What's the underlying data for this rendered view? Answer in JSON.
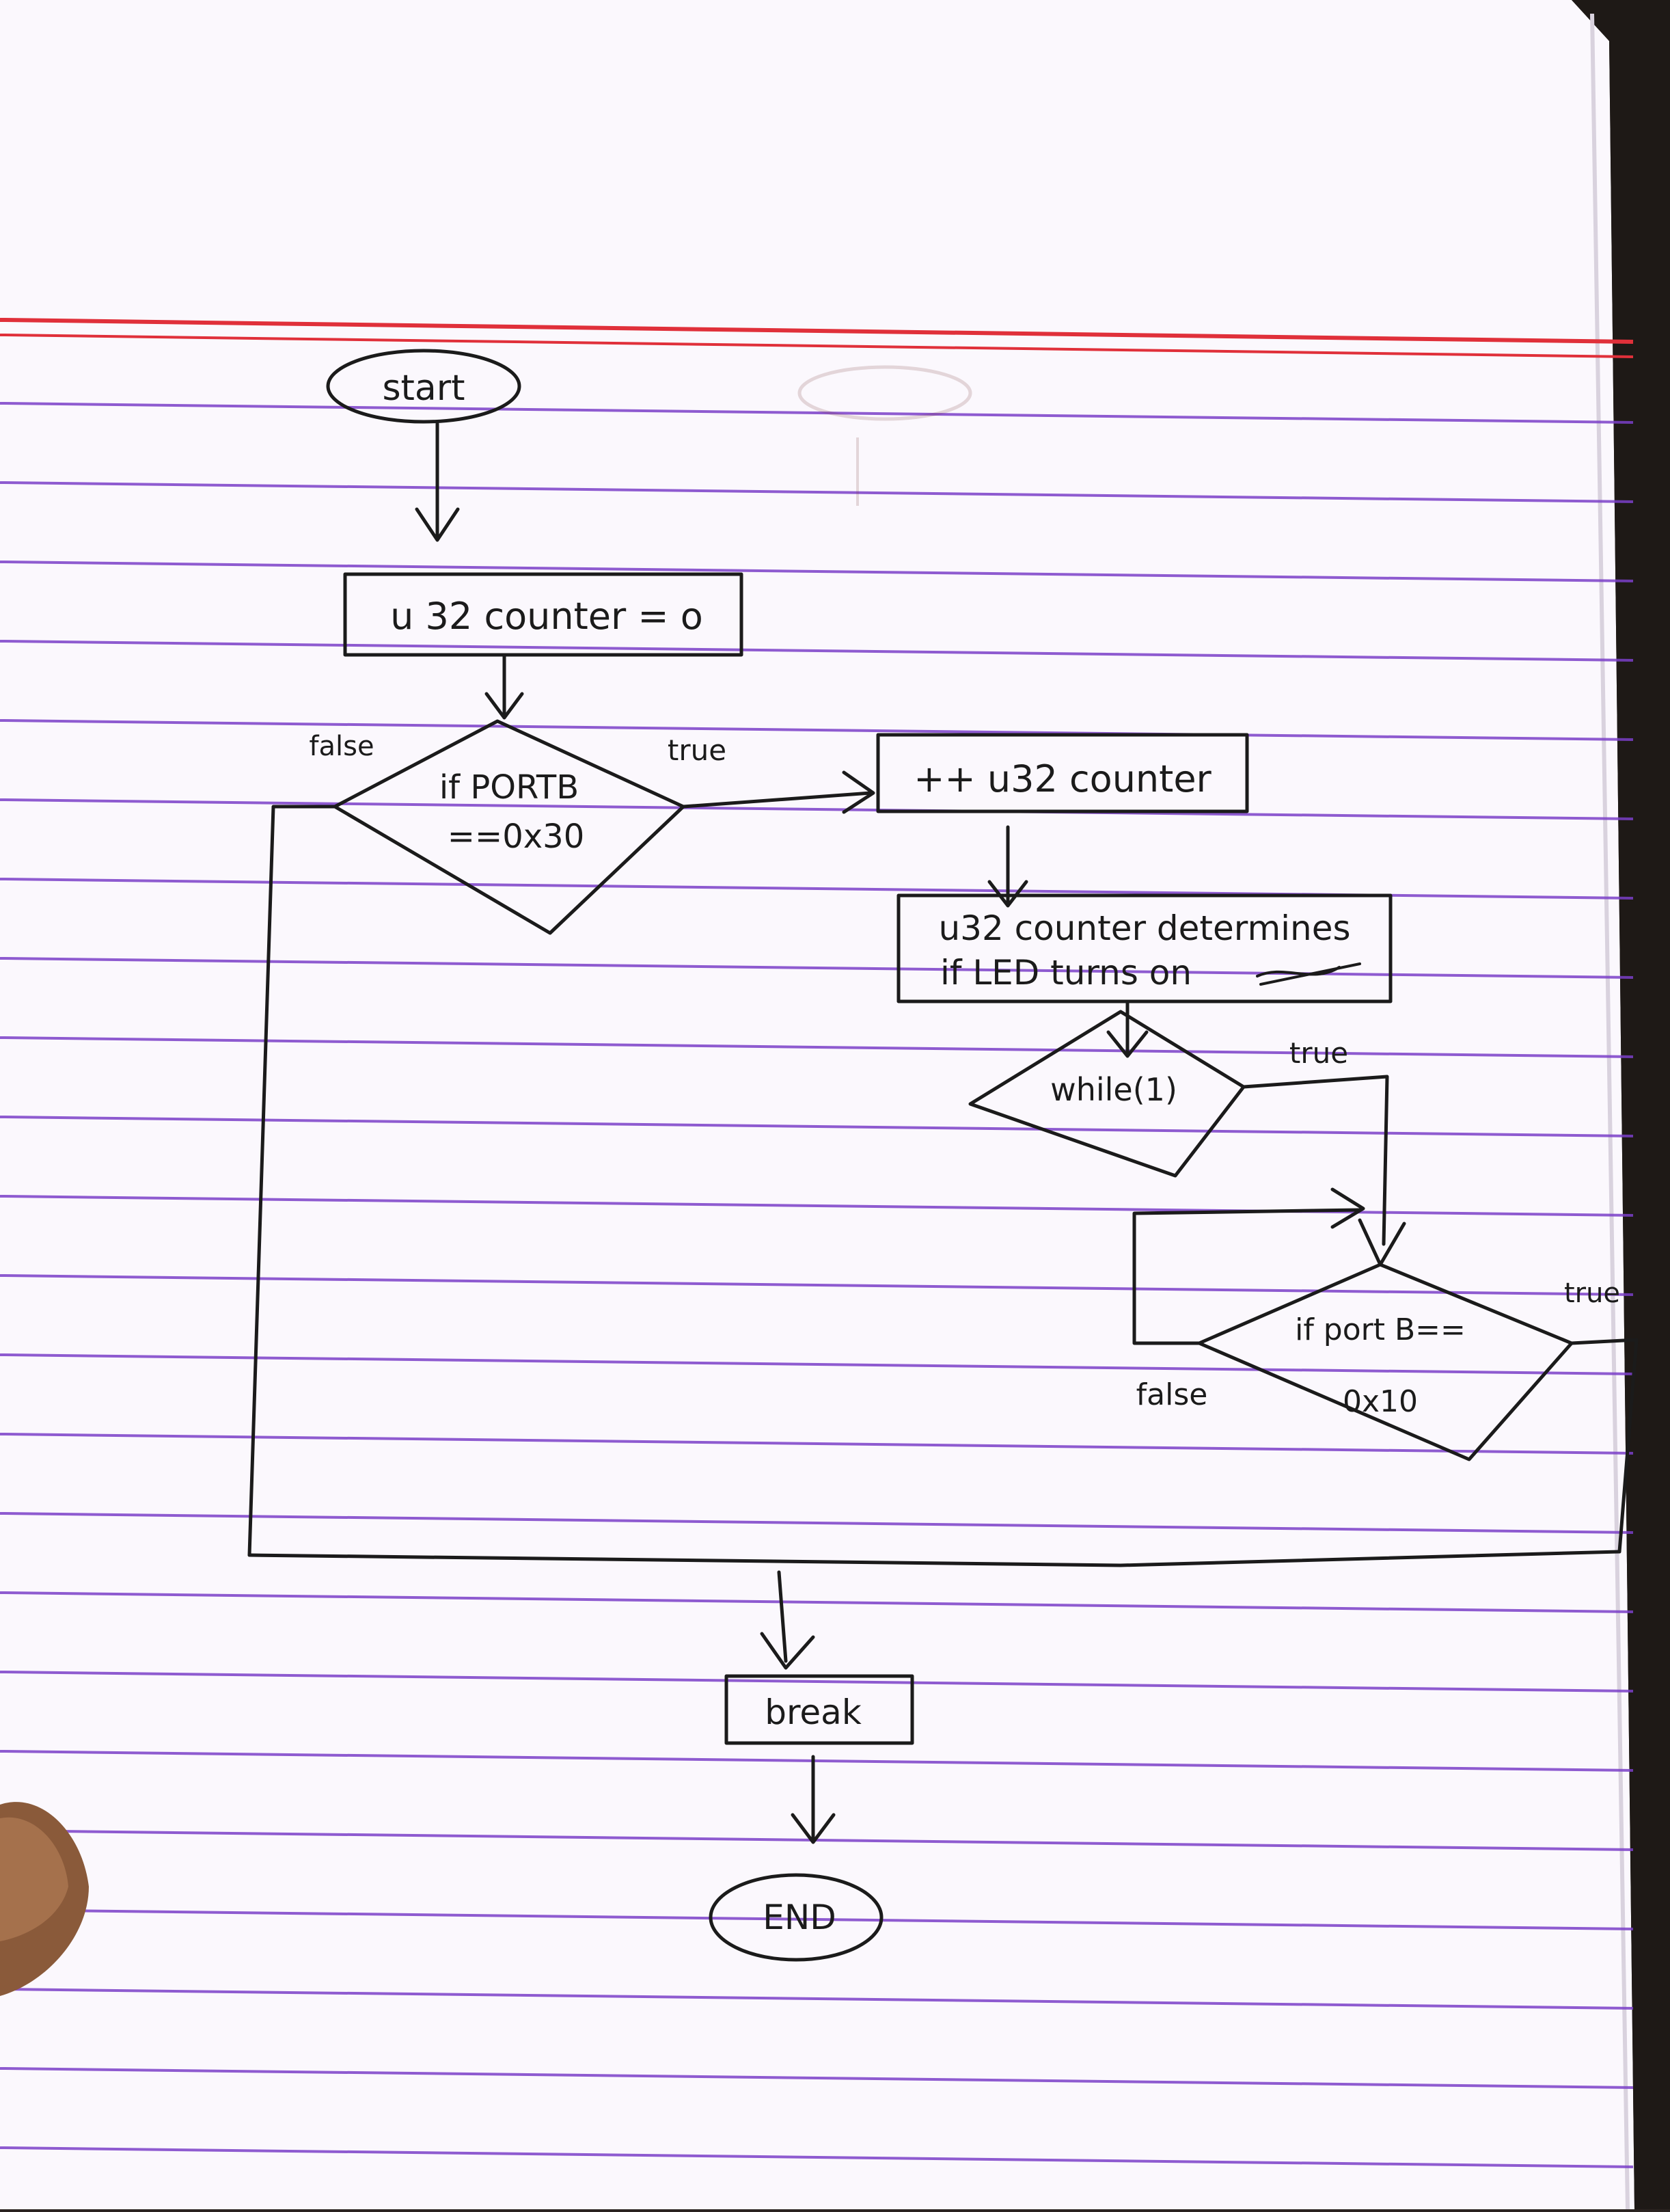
{
  "flowchart": {
    "start": "start",
    "init": "u 32 counter = o",
    "decision1": {
      "line1": "if PORTB",
      "line2": "==0x30",
      "true_label": "true",
      "false_label": "false"
    },
    "increment": "++ u32 counter",
    "note": {
      "line1": "u32 counter determines",
      "line2": "if LED turns on"
    },
    "loop": {
      "text": "while(1)",
      "true_label": "true"
    },
    "decision2": {
      "line1": "if port B==",
      "line2": "0x10",
      "true_label": "true",
      "false_label": "false"
    },
    "break": "break",
    "end": "END"
  },
  "colors": {
    "paper": "#fbf8fd",
    "ink": "#1b1b1b",
    "rule_line": "#7a3fc8",
    "margin_line": "#e0303a"
  }
}
